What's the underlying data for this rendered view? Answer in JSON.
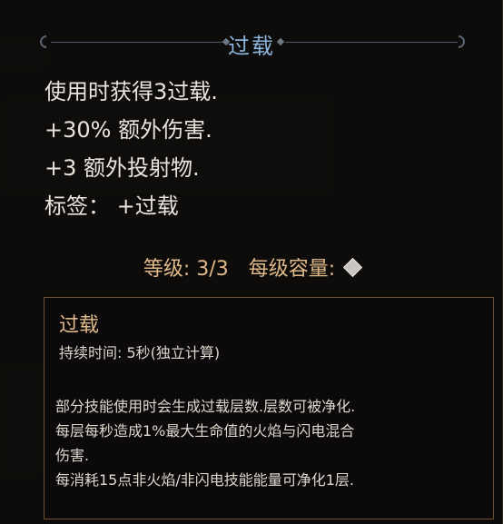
{
  "header": {
    "title": "过载"
  },
  "effects": [
    "使用时获得3过载.",
    "+30% 额外伤害.",
    "+3 额外投射物.",
    "标签： +过载"
  ],
  "level": {
    "label": "等级: 3/3",
    "capacity_label": "每级容量:",
    "capacity_icon": "diamond-icon"
  },
  "detail": {
    "title": "过载",
    "duration": "持续时间: 5秒(独立计算)",
    "lines": [
      "部分技能使用时会生成过载层数.层数可被净化.",
      "每层每秒造成1%最大生命值的火焰与闪电混合",
      "伤害.",
      "每消耗15点非火焰/非闪电技能能量可净化1层."
    ]
  },
  "colors": {
    "title": "#8cb3dc",
    "accent": "#e0b98a",
    "text": "#e8e4dc",
    "border": "#6d5334"
  }
}
